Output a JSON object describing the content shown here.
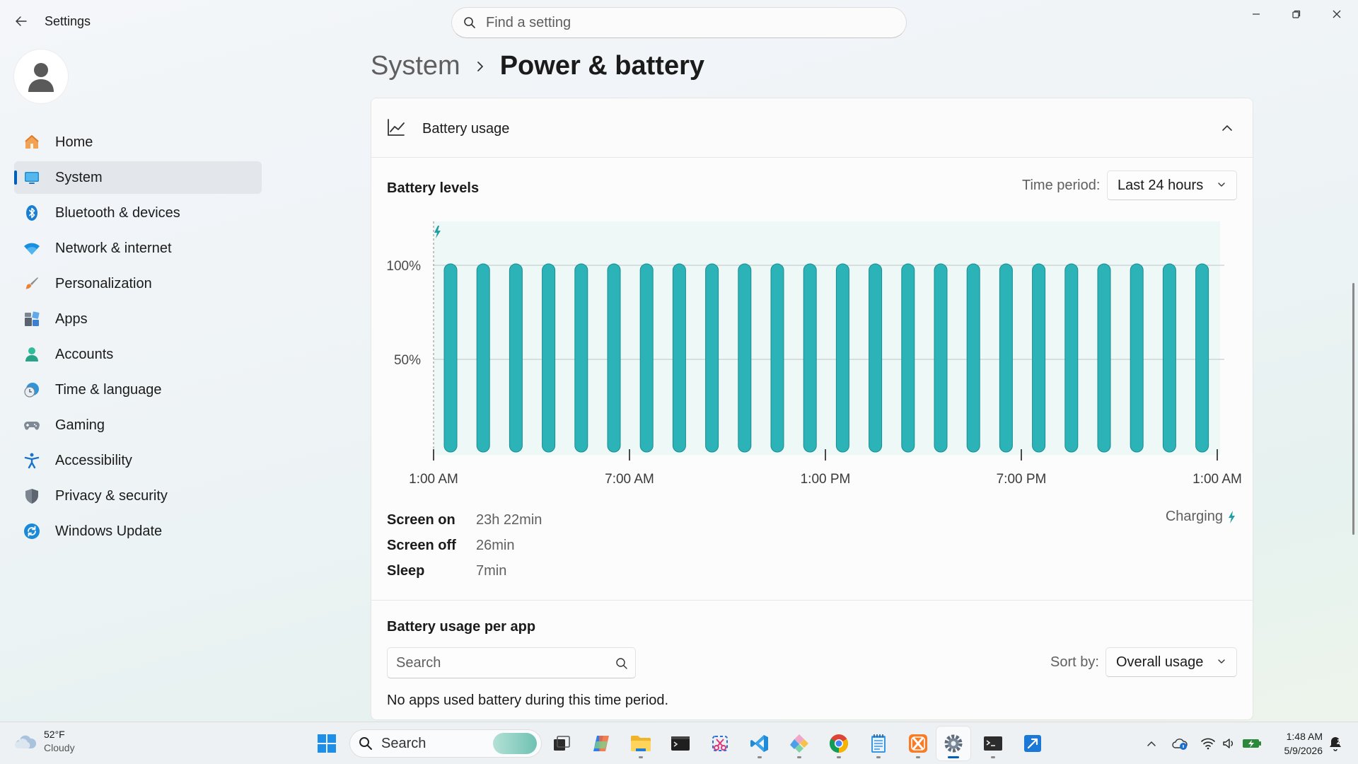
{
  "window": {
    "title": "Settings",
    "search_placeholder": "Find a setting"
  },
  "sidebar": {
    "items": [
      {
        "label": "Home",
        "icon": "home-icon"
      },
      {
        "label": "System",
        "icon": "system-icon",
        "active": true
      },
      {
        "label": "Bluetooth & devices",
        "icon": "bluetooth-icon"
      },
      {
        "label": "Network & internet",
        "icon": "wifi-icon"
      },
      {
        "label": "Personalization",
        "icon": "brush-icon"
      },
      {
        "label": "Apps",
        "icon": "apps-icon"
      },
      {
        "label": "Accounts",
        "icon": "accounts-icon"
      },
      {
        "label": "Time & language",
        "icon": "clock-globe-icon"
      },
      {
        "label": "Gaming",
        "icon": "gamepad-icon"
      },
      {
        "label": "Accessibility",
        "icon": "accessibility-icon"
      },
      {
        "label": "Privacy & security",
        "icon": "shield-icon"
      },
      {
        "label": "Windows Update",
        "icon": "update-icon"
      }
    ]
  },
  "breadcrumb": {
    "parent": "System",
    "current": "Power & battery"
  },
  "battery_usage": {
    "title": "Battery usage",
    "levels_title": "Battery levels",
    "time_period_label": "Time period:",
    "time_period_value": "Last 24 hours",
    "stats": [
      {
        "label": "Screen on",
        "value": "23h 22min"
      },
      {
        "label": "Screen off",
        "value": "26min"
      },
      {
        "label": "Sleep",
        "value": "7min"
      }
    ],
    "status": "Charging"
  },
  "per_app": {
    "title": "Battery usage per app",
    "search_placeholder": "Search",
    "sort_label": "Sort by:",
    "sort_value": "Overall usage",
    "empty_message": "No apps used battery during this time period."
  },
  "chart_data": {
    "type": "bar",
    "title": "Battery levels",
    "x_tick_labels": [
      "1:00 AM",
      "7:00 AM",
      "1:00 PM",
      "7:00 PM",
      "1:00 AM"
    ],
    "y_tick_labels": [
      "100%",
      "50%"
    ],
    "ylim": [
      0,
      100
    ],
    "values": [
      100,
      100,
      100,
      100,
      100,
      100,
      100,
      100,
      100,
      100,
      100,
      100,
      100,
      100,
      100,
      100,
      100,
      100,
      100,
      100,
      100,
      100,
      100,
      100
    ],
    "bar_color": "#2bb3b8",
    "background_color": "#eef8f7",
    "grid": true
  },
  "taskbar": {
    "weather_temp": "52°F",
    "weather_condition": "Cloudy",
    "search_label": "Search",
    "time": "1:48 AM",
    "date": "5/9/2026",
    "accent": "#005fb8"
  }
}
